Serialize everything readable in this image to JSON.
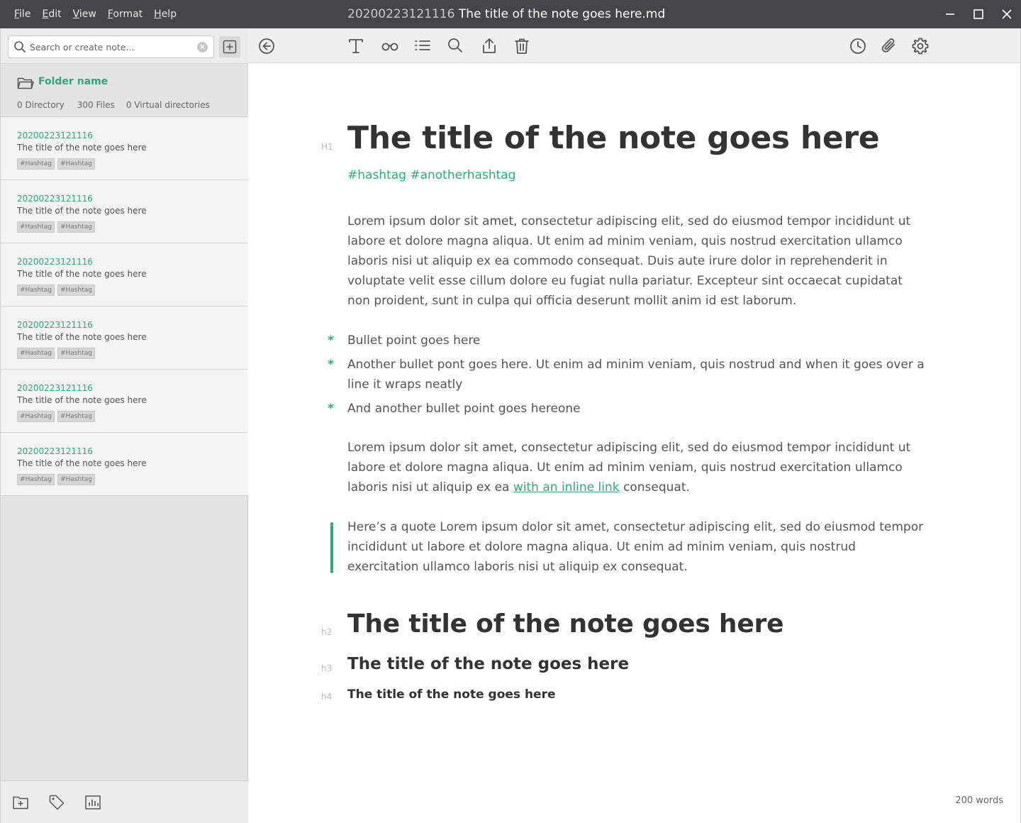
{
  "menu": [
    "File",
    "Edit",
    "View",
    "Format",
    "Help"
  ],
  "window": {
    "title_stamp": "20200223121116",
    "title_text": "The title of the note goes here.md"
  },
  "search": {
    "placeholder": "Search or create note..."
  },
  "folder": {
    "name": "Folder name",
    "directories": "0 Directory",
    "files": "300 Files",
    "virtual": "0 Virtual directories"
  },
  "notes": [
    {
      "stamp": "20200223121116",
      "title": "The title of the note goes here",
      "tags": [
        "#Hashtag",
        "#Hashtag"
      ]
    },
    {
      "stamp": "20200223121116",
      "title": "The title of the note goes here",
      "tags": [
        "#Hashtag",
        "#Hashtag"
      ]
    },
    {
      "stamp": "20200223121116",
      "title": "The title of the note goes here",
      "tags": [
        "#Hashtag",
        "#Hashtag"
      ]
    },
    {
      "stamp": "20200223121116",
      "title": "The title of the note goes here",
      "tags": [
        "#Hashtag",
        "#Hashtag"
      ]
    },
    {
      "stamp": "20200223121116",
      "title": "The title of the note goes here",
      "tags": [
        "#Hashtag",
        "#Hashtag"
      ]
    },
    {
      "stamp": "20200223121116",
      "title": "The title of the note goes here",
      "tags": [
        "#Hashtag",
        "#Hashtag"
      ]
    }
  ],
  "doc": {
    "h1_marker": "H1",
    "h1": "The title of the note goes here",
    "hashtags": "#hashtag #anotherhashtag",
    "para1": "Lorem ipsum dolor sit amet, consectetur adipiscing elit, sed do eiusmod tempor incididunt ut labore et dolore magna aliqua. Ut enim ad minim veniam, quis nostrud exercitation ullamco laboris nisi ut aliquip ex ea commodo consequat. Duis aute irure dolor in reprehenderit in voluptate velit esse cillum dolore eu fugiat nulla pariatur. Excepteur sint occaecat cupidatat non proident, sunt in culpa qui officia deserunt mollit anim id est laborum.",
    "bullet_marker": "*",
    "bullets": [
      "Bullet point goes here",
      "Another bullet pont goes here. Ut enim ad minim veniam, quis nostrud and when it goes over a line it wraps neatly",
      "And another bullet point goes hereone"
    ],
    "para2_before": "Lorem ipsum dolor sit amet, consectetur adipiscing elit, sed do eiusmod tempor incididunt ut labore et dolore magna aliqua. Ut enim ad minim veniam, quis nostrud exercitation ullamco laboris nisi ut aliquip ex ea ",
    "para2_link": "with an inline link",
    "para2_after": " consequat.",
    "quote": "Here’s a quote Lorem ipsum dolor sit amet, consectetur adipiscing elit, sed do eiusmod tempor incididunt ut labore et dolore magna aliqua. Ut enim ad minim veniam, quis nostrud exercitation ullamco laboris nisi ut aliquip ex consequat.",
    "h2_marker": "h2",
    "h2": "The title of the note goes here",
    "h3_marker": "h3",
    "h3": "The title of the note goes here",
    "h4_marker": "h4",
    "h4": "The title of the note goes here"
  },
  "status": {
    "wordcount": "200 words"
  },
  "colors": {
    "accent": "#2bab79",
    "titlebar": "#45464c"
  }
}
